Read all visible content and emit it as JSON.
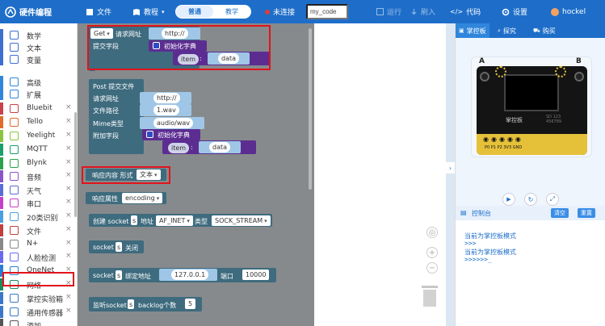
{
  "topbar": {
    "title": "硬件编程",
    "file": "文件",
    "tutorial": "教程",
    "mode_normal": "普通",
    "mode_teach": "教学",
    "connection": "未连接",
    "filename": "my_code",
    "run": "运行",
    "flash": "刷入",
    "code": "代码",
    "settings": "设置",
    "user": "hockel",
    "colors": {
      "bar": "#1e6ec9",
      "status_dot": "#e23b3b"
    }
  },
  "sidebar": {
    "items": [
      {
        "label": "数学",
        "color": "#3d6fd0",
        "icon": "grid-icon",
        "closable": false
      },
      {
        "label": "文本",
        "color": "#3d6fd0",
        "icon": "text-icon",
        "closable": false
      },
      {
        "label": "变量",
        "color": "#3d6fd0",
        "icon": "variable-icon",
        "closable": false
      },
      {
        "label": "高级",
        "color": "#2f86db",
        "icon": "chevron-right-icon",
        "closable": false
      },
      {
        "label": "扩展",
        "color": "#2f86db",
        "icon": "chevron-down-icon",
        "closable": false
      },
      {
        "label": "Bluebit",
        "color": "#c9414b",
        "icon": "bluebit-icon",
        "closable": true
      },
      {
        "label": "Tello",
        "color": "#e36a2b",
        "icon": "drone-icon",
        "closable": true
      },
      {
        "label": "Yeelight",
        "color": "#8bc540",
        "icon": "bulb-icon",
        "closable": true
      },
      {
        "label": "MQTT",
        "color": "#1aa06d",
        "icon": "mqtt-icon",
        "closable": true
      },
      {
        "label": "Blynk",
        "color": "#2aa24b",
        "icon": "blynk-icon",
        "closable": true
      },
      {
        "label": "音频",
        "color": "#8d53c9",
        "icon": "audio-icon",
        "closable": true
      },
      {
        "label": "天气",
        "color": "#5b6cd6",
        "icon": "weather-icon",
        "closable": true
      },
      {
        "label": "串口",
        "color": "#c73ec7",
        "icon": "serial-icon",
        "closable": true
      },
      {
        "label": "20类识别",
        "color": "#4a9fe0",
        "icon": "recognition-icon",
        "closable": true
      },
      {
        "label": "文件",
        "color": "#c23f3f",
        "icon": "file-icon",
        "closable": true
      },
      {
        "label": "N+",
        "color": "#888888",
        "icon": "nplus-icon",
        "closable": true
      },
      {
        "label": "人脸检测",
        "color": "#6a6af0",
        "icon": "face-icon",
        "closable": true
      },
      {
        "label": "OneNet",
        "color": "#2a7fd4",
        "icon": "cloud-icon",
        "closable": true
      },
      {
        "label": "网络",
        "color": "#1a8c5e",
        "icon": "network-icon",
        "closable": true
      },
      {
        "label": "掌控实验箱",
        "color": "#3b78c9",
        "icon": "lab-icon",
        "closable": true
      },
      {
        "label": "通用传感器",
        "color": "#3b78c9",
        "icon": "sensor-icon",
        "closable": true
      },
      {
        "label": "添加",
        "color": "#555555",
        "icon": "add-icon",
        "closable": false
      }
    ]
  },
  "blocks": {
    "get": {
      "method": "Get",
      "req_url": "请求网址",
      "url": "http://",
      "field": "提交字段",
      "init_dict": "初始化字典",
      "key": "item",
      "value": "data"
    },
    "post": {
      "title": "Post 提交文件",
      "req_url": "请求网址",
      "url": "http://",
      "path_label": "文件路径",
      "path": "1.wav",
      "mime_label": "Mime类型",
      "mime": "audio/wav",
      "field": "附加字段",
      "init_dict": "初始化字典",
      "key": "item",
      "value": "data"
    },
    "resp": {
      "label": "响应内容 形式",
      "type": "文本"
    },
    "attr": {
      "label": "响应属性",
      "value": "encoding"
    },
    "socket_create": {
      "prefix": "创建 socket",
      "var": "s",
      "addr": "地址",
      "af": "AF_INET",
      "type": "类型",
      "st": "SOCK_STREAM"
    },
    "socket_close": {
      "prefix": "socket",
      "var": "s",
      "action": "关闭"
    },
    "socket_bind": {
      "prefix": "socket",
      "var": "s",
      "action": "绑定地址",
      "ip": "127.0.0.1",
      "port_label": "端口",
      "port": "10000"
    },
    "socket_listen": {
      "prefix": "监听socket",
      "var": "s",
      "label": "backlog个数",
      "num": "5"
    }
  },
  "right": {
    "tabs": [
      "掌控板",
      "探究",
      "购买"
    ],
    "console_title": "控制台",
    "clear": "清空",
    "reset": "重置",
    "console_lines": [
      "当前为掌控板模式",
      ">>>",
      "当前为掌控板模式",
      ">>>>>>_"
    ],
    "board": {
      "btn_a": "A",
      "btn_b": "B",
      "logo": "掌控板",
      "serial": "SD 123\n456789",
      "pins": "P0 P1 P2 3V3 GND"
    }
  }
}
